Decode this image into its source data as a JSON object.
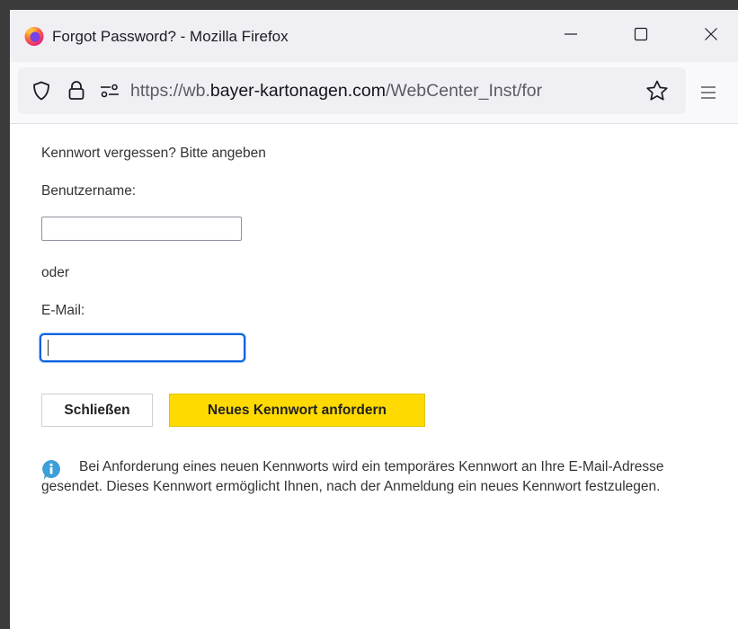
{
  "window": {
    "title": "Forgot Password? - Mozilla Firefox"
  },
  "urlbar": {
    "url_prefix": "https://wb.",
    "url_domain": "bayer-kartonagen.com",
    "url_path": "/WebCenter_Inst/for"
  },
  "form": {
    "heading": "Kennwort vergessen? Bitte angeben",
    "username_label": "Benutzername:",
    "username_value": "",
    "or_label": "oder",
    "email_label": "E-Mail:",
    "email_value": "",
    "close_button": "Schließen",
    "request_button": "Neues Kennwort anfordern"
  },
  "info": {
    "text": "Bei Anforderung eines neuen Kennworts wird ein temporäres Kennwort an Ihre E-Mail-Adresse gesendet. Dieses Kennwort ermöglicht Ihnen, nach der Anmeldung ein neues Kennwort festzulegen."
  },
  "colors": {
    "accent_yellow": "#ffda00",
    "focus_blue": "#0060df",
    "info_icon": "#3d9fd8"
  },
  "icons": [
    "firefox-logo",
    "minimize-icon",
    "maximize-icon",
    "close-icon",
    "shield-icon",
    "lock-icon",
    "permissions-icon",
    "bookmark-star-icon",
    "hamburger-menu-icon",
    "info-icon"
  ]
}
